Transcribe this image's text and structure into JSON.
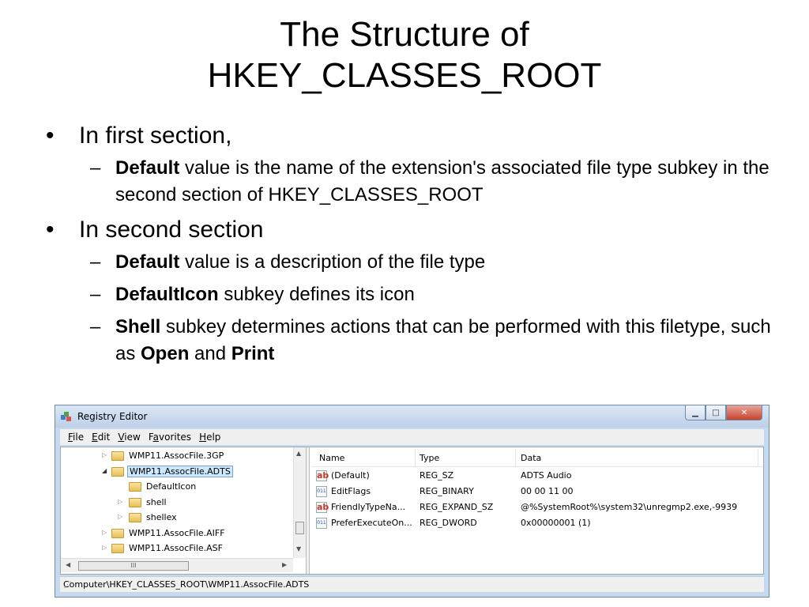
{
  "slide": {
    "title_line1": "The Structure of",
    "title_line2": "HKEY_CLASSES_ROOT"
  },
  "bullets": [
    {
      "text": "In first section,"
    },
    {
      "text": "In second section"
    }
  ],
  "sub": {
    "a": {
      "bold": "Default",
      "rest": " value is the name of the extension's associated file type subkey in the second section of HKEY_CLASSES_ROOT"
    },
    "b": {
      "bold": "Default",
      "rest": " value is a description of the file type"
    },
    "c": {
      "bold": "DefaultIcon",
      "rest": " subkey defines its icon"
    },
    "d": {
      "bold": "Shell",
      "rest": " subkey determines actions that can be performed with this filetype, such as ",
      "open": "Open",
      "and": " and ",
      "print": "Print"
    }
  },
  "marks": {
    "bullet": "•",
    "dash": "–"
  },
  "regedit": {
    "title": "Registry Editor",
    "menu": {
      "file": {
        "key": "F",
        "rest": "ile"
      },
      "edit": {
        "key": "E",
        "rest": "dit"
      },
      "view": {
        "key": "V",
        "rest": "iew"
      },
      "favorites": {
        "pre": "F",
        "key": "a",
        "rest": "vorites"
      },
      "help": {
        "key": "H",
        "rest": "elp"
      }
    },
    "tree": [
      "WMP11.AssocFile.3GP",
      "WMP11.AssocFile.ADTS",
      "DefaultIcon",
      "shell",
      "shellex",
      "WMP11.AssocFile.AIFF",
      "WMP11.AssocFile.ASF"
    ],
    "columns": {
      "name": "Name",
      "type": "Type",
      "data": "Data"
    },
    "rows": [
      {
        "icon": "ab",
        "name": "(Default)",
        "type": "REG_SZ",
        "data": "ADTS Audio"
      },
      {
        "icon": "011",
        "name": "EditFlags",
        "type": "REG_BINARY",
        "data": "00 00 11 00"
      },
      {
        "icon": "ab",
        "name": "FriendlyTypeNa...",
        "type": "REG_EXPAND_SZ",
        "data": "@%SystemRoot%\\system32\\unregmp2.exe,-9939"
      },
      {
        "icon": "011",
        "name": "PreferExecuteOn...",
        "type": "REG_DWORD",
        "data": "0x00000001 (1)"
      }
    ],
    "status": "Computer\\HKEY_CLASSES_ROOT\\WMP11.AssocFile.ADTS",
    "hscroll_thumb": "III"
  },
  "icons": [
    "app-registry-icon",
    "minimize-icon",
    "maximize-icon",
    "close-icon",
    "folder-icon",
    "expand-arrow-icon",
    "collapse-arrow-icon",
    "string-value-icon",
    "binary-value-icon",
    "scroll-up-icon",
    "scroll-down-icon",
    "scroll-left-icon",
    "scroll-right-icon",
    "resize-grip-icon"
  ],
  "colors": {
    "selection": "#cce8ff",
    "window_frame": "#c7d9ee",
    "close_button": "#c7432d"
  }
}
